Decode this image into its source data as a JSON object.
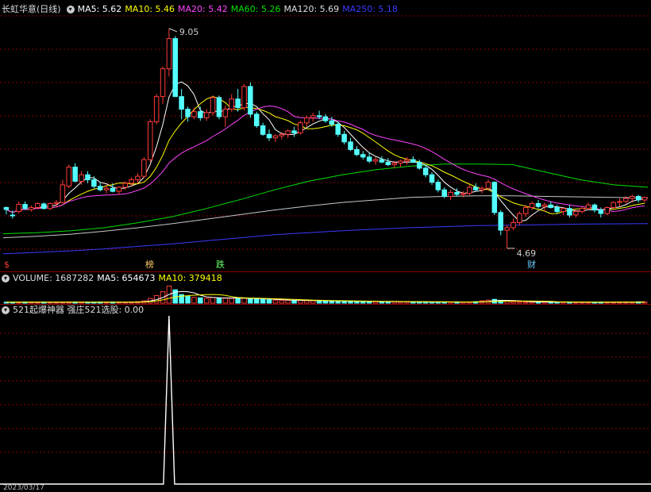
{
  "price_header": {
    "title": "长虹华意(日线)",
    "ma5": "MA5: 5.62",
    "ma10": "MA10: 5.46",
    "ma20": "MA20: 5.42",
    "ma60": "MA60: 5.26",
    "ma120": "MA120: 5.69",
    "ma250": "MA250: 5.18"
  },
  "volume_header": {
    "label": "VOLUME: 1687282",
    "ma5": "MA5: 654673",
    "ma10": "MA10: 379418"
  },
  "indicator_header": {
    "label": "521起爆神器 强庄521选股: 0.00"
  },
  "markers": {
    "m1": "$",
    "m2": "榜",
    "m3": "跌",
    "m4": "财"
  },
  "annotations": {
    "high": "9.05",
    "low": "4.69"
  },
  "footer_date": "2023/03/17",
  "colors": {
    "up": "#ff3c3c",
    "down": "#54ffff",
    "ma5": "#ffffff",
    "ma10": "#ffff00",
    "ma20": "#ff44ff",
    "ma60": "#00e000",
    "ma120": "#c8c8c8",
    "ma250": "#3a3aff",
    "grid": "#8b0000"
  },
  "chart_data": [
    {
      "type": "candlestick",
      "title": "长虹华意(日线)",
      "ylim": [
        4.5,
        9.3
      ],
      "annotations": [
        {
          "label": "9.05",
          "value": 9.05
        },
        {
          "label": "4.69",
          "value": 4.69
        }
      ],
      "ohlc": [
        [
          5.5,
          5.52,
          5.36,
          5.46
        ],
        [
          5.35,
          5.44,
          5.28,
          5.34
        ],
        [
          5.42,
          5.62,
          5.38,
          5.56
        ],
        [
          5.56,
          5.62,
          5.45,
          5.48
        ],
        [
          5.46,
          5.54,
          5.42,
          5.5
        ],
        [
          5.5,
          5.6,
          5.46,
          5.58
        ],
        [
          5.57,
          5.6,
          5.46,
          5.48
        ],
        [
          5.48,
          5.6,
          5.45,
          5.58
        ],
        [
          5.58,
          5.65,
          5.5,
          5.6
        ],
        [
          5.6,
          6.05,
          5.58,
          5.95
        ],
        [
          5.92,
          6.35,
          5.88,
          6.3
        ],
        [
          6.3,
          6.38,
          6.0,
          6.02
        ],
        [
          6.02,
          6.22,
          5.95,
          6.15
        ],
        [
          6.15,
          6.22,
          5.98,
          6.05
        ],
        [
          6.05,
          6.12,
          5.88,
          5.92
        ],
        [
          5.92,
          6.0,
          5.82,
          5.85
        ],
        [
          5.85,
          5.95,
          5.78,
          5.88
        ],
        [
          5.88,
          5.98,
          5.8,
          5.82
        ],
        [
          5.82,
          5.92,
          5.75,
          5.9
        ],
        [
          5.9,
          6.02,
          5.85,
          5.98
        ],
        [
          5.98,
          6.1,
          5.92,
          6.05
        ],
        [
          6.05,
          6.18,
          5.98,
          6.12
        ],
        [
          6.12,
          6.5,
          6.08,
          6.45
        ],
        [
          6.45,
          7.25,
          6.4,
          7.2
        ],
        [
          7.2,
          7.75,
          7.15,
          7.7
        ],
        [
          7.7,
          8.3,
          7.55,
          8.25
        ],
        [
          8.25,
          9.05,
          8.1,
          8.85
        ],
        [
          8.85,
          8.9,
          7.7,
          7.7
        ],
        [
          7.7,
          7.85,
          7.25,
          7.45
        ],
        [
          7.45,
          7.5,
          7.2,
          7.3
        ],
        [
          7.3,
          7.48,
          7.25,
          7.4
        ],
        [
          7.4,
          7.5,
          7.22,
          7.28
        ],
        [
          7.28,
          7.45,
          7.22,
          7.38
        ],
        [
          7.38,
          7.72,
          7.32,
          7.68
        ],
        [
          7.68,
          7.72,
          7.25,
          7.3
        ],
        [
          7.3,
          7.52,
          7.1,
          7.45
        ],
        [
          7.45,
          7.75,
          7.4,
          7.65
        ],
        [
          7.65,
          7.85,
          7.4,
          7.48
        ],
        [
          7.48,
          7.95,
          7.42,
          7.9
        ],
        [
          7.9,
          7.98,
          7.28,
          7.35
        ],
        [
          7.35,
          7.4,
          7.08,
          7.12
        ],
        [
          7.12,
          7.18,
          6.92,
          6.95
        ],
        [
          6.95,
          7.05,
          6.82,
          6.88
        ],
        [
          6.88,
          6.95,
          6.8,
          6.92
        ],
        [
          6.92,
          7.0,
          6.85,
          6.95
        ],
        [
          6.95,
          7.05,
          6.88,
          7.02
        ],
        [
          7.02,
          7.1,
          6.9,
          6.98
        ],
        [
          6.98,
          7.22,
          6.95,
          7.18
        ],
        [
          7.18,
          7.32,
          7.1,
          7.28
        ],
        [
          7.28,
          7.38,
          7.2,
          7.32
        ],
        [
          7.32,
          7.42,
          7.25,
          7.3
        ],
        [
          7.3,
          7.35,
          7.18,
          7.22
        ],
        [
          7.22,
          7.3,
          7.1,
          7.15
        ],
        [
          7.15,
          7.2,
          6.9,
          6.95
        ],
        [
          6.95,
          7.02,
          6.75,
          6.8
        ],
        [
          6.8,
          6.88,
          6.62,
          6.65
        ],
        [
          6.65,
          6.72,
          6.52,
          6.55
        ],
        [
          6.55,
          6.62,
          6.45,
          6.5
        ],
        [
          6.5,
          6.58,
          6.38,
          6.42
        ],
        [
          6.42,
          6.5,
          6.35,
          6.45
        ],
        [
          6.45,
          6.52,
          6.38,
          6.4
        ],
        [
          6.4,
          6.48,
          6.32,
          6.35
        ],
        [
          6.35,
          6.42,
          6.28,
          6.38
        ],
        [
          6.38,
          6.45,
          6.3,
          6.42
        ],
        [
          6.42,
          6.5,
          6.35,
          6.45
        ],
        [
          6.45,
          6.52,
          6.38,
          6.4
        ],
        [
          6.4,
          6.45,
          6.25,
          6.28
        ],
        [
          6.28,
          6.35,
          6.1,
          6.15
        ],
        [
          6.15,
          6.2,
          5.95,
          6.0
        ],
        [
          6.0,
          6.05,
          5.8,
          5.85
        ],
        [
          5.85,
          5.9,
          5.68,
          5.72
        ],
        [
          5.72,
          5.85,
          5.65,
          5.8
        ],
        [
          5.8,
          5.88,
          5.72,
          5.76
        ],
        [
          5.76,
          5.82,
          5.7,
          5.78
        ],
        [
          5.78,
          5.95,
          5.74,
          5.9
        ],
        [
          5.9,
          5.98,
          5.82,
          5.85
        ],
        [
          5.85,
          5.92,
          5.78,
          5.88
        ],
        [
          5.88,
          6.05,
          5.85,
          6.0
        ],
        [
          6.0,
          6.02,
          5.35,
          5.4
        ],
        [
          5.4,
          5.45,
          4.95,
          5.05
        ],
        [
          5.05,
          5.15,
          4.69,
          5.1
        ],
        [
          5.1,
          5.28,
          5.05,
          5.2
        ],
        [
          5.2,
          5.42,
          5.15,
          5.38
        ],
        [
          5.38,
          5.55,
          5.32,
          5.5
        ],
        [
          5.5,
          5.62,
          5.45,
          5.58
        ],
        [
          5.58,
          5.65,
          5.48,
          5.52
        ],
        [
          5.52,
          5.6,
          5.42,
          5.55
        ],
        [
          5.55,
          5.62,
          5.48,
          5.5
        ],
        [
          5.5,
          5.55,
          5.38,
          5.42
        ],
        [
          5.42,
          5.5,
          5.35,
          5.48
        ],
        [
          5.48,
          5.55,
          5.3,
          5.35
        ],
        [
          5.35,
          5.45,
          5.3,
          5.42
        ],
        [
          5.42,
          5.52,
          5.38,
          5.48
        ],
        [
          5.48,
          5.6,
          5.45,
          5.55
        ],
        [
          5.55,
          5.58,
          5.4,
          5.45
        ],
        [
          5.45,
          5.5,
          5.3,
          5.38
        ],
        [
          5.38,
          5.52,
          5.35,
          5.5
        ],
        [
          5.5,
          5.62,
          5.48,
          5.6
        ],
        [
          5.6,
          5.68,
          5.52,
          5.62
        ],
        [
          5.62,
          5.72,
          5.58,
          5.68
        ],
        [
          5.68,
          5.75,
          5.6,
          5.72
        ],
        [
          5.72,
          5.75,
          5.6,
          5.65
        ],
        [
          5.65,
          5.72,
          5.6,
          5.7
        ]
      ],
      "ma_series": [
        {
          "name": "MA5",
          "color_key": "ma5",
          "period": 5
        },
        {
          "name": "MA10",
          "color_key": "ma10",
          "period": 10
        },
        {
          "name": "MA20",
          "color_key": "ma20",
          "period": 20
        }
      ],
      "long_ma_series": [
        {
          "name": "MA60",
          "color_key": "ma60",
          "values": [
            4.98,
            5.0,
            5.04,
            5.1,
            5.2,
            5.32,
            5.48,
            5.66,
            5.85,
            6.02,
            6.15,
            6.25,
            6.32,
            6.36,
            6.36,
            6.35,
            6.2,
            6.05,
            5.95,
            5.9
          ]
        },
        {
          "name": "MA120",
          "color_key": "ma120",
          "values": [
            4.9,
            4.93,
            4.97,
            5.03,
            5.1,
            5.18,
            5.27,
            5.36,
            5.45,
            5.53,
            5.6,
            5.65,
            5.7,
            5.72,
            5.73,
            5.73,
            5.72,
            5.71,
            5.7,
            5.69
          ]
        },
        {
          "name": "MA250",
          "color_key": "ma250",
          "values": [
            4.58,
            4.61,
            4.64,
            4.68,
            4.73,
            4.78,
            4.84,
            4.9,
            4.96,
            5.0,
            5.04,
            5.07,
            5.1,
            5.12,
            5.14,
            5.15,
            5.16,
            5.17,
            5.175,
            5.18
          ]
        }
      ]
    },
    {
      "type": "bar",
      "title": "VOLUME",
      "values_relative": [
        0.05,
        0.05,
        0.05,
        0.05,
        0.05,
        0.05,
        0.05,
        0.05,
        0.05,
        0.05,
        0.06,
        0.06,
        0.05,
        0.05,
        0.05,
        0.05,
        0.05,
        0.05,
        0.05,
        0.05,
        0.06,
        0.08,
        0.12,
        0.25,
        0.4,
        0.6,
        0.9,
        0.7,
        0.45,
        0.35,
        0.3,
        0.28,
        0.26,
        0.3,
        0.28,
        0.26,
        0.25,
        0.24,
        0.26,
        0.24,
        0.22,
        0.2,
        0.18,
        0.16,
        0.15,
        0.15,
        0.14,
        0.14,
        0.13,
        0.13,
        0.12,
        0.12,
        0.11,
        0.11,
        0.1,
        0.1,
        0.09,
        0.09,
        0.09,
        0.08,
        0.08,
        0.08,
        0.08,
        0.07,
        0.07,
        0.07,
        0.07,
        0.07,
        0.06,
        0.06,
        0.06,
        0.06,
        0.06,
        0.06,
        0.06,
        0.08,
        0.12,
        0.16,
        0.2,
        0.15,
        0.1,
        0.08,
        0.07,
        0.06,
        0.06,
        0.06,
        0.06,
        0.06,
        0.06,
        0.06,
        0.05,
        0.05,
        0.05,
        0.05,
        0.05,
        0.05,
        0.05,
        0.05,
        0.05,
        0.06,
        0.06,
        0.07,
        0.07
      ]
    },
    {
      "type": "line",
      "title": "521起爆神器 强庄521选股",
      "ylim": [
        0,
        1
      ],
      "spike_index": 26,
      "spike_value": 1
    }
  ]
}
